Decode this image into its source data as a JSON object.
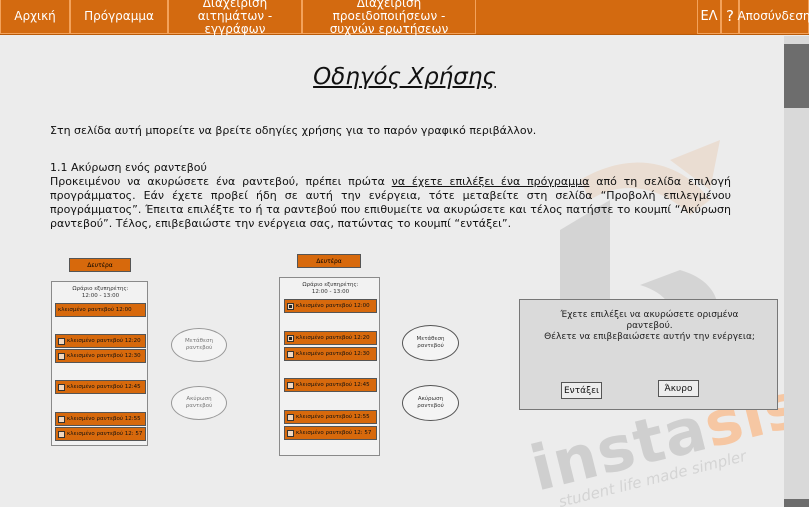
{
  "nav": {
    "home": "Αρχική",
    "program": "Πρόγραμμα",
    "requests_line1": "Διαχείριση",
    "requests_line2": "αιτημάτων - εγγράφων",
    "notifications_line1": "Διαχείριση προειδοποιήσεων -",
    "notifications_line2": "συχνών ερωτήσεων",
    "language": "ΕΛ",
    "help": "?",
    "logout": "Αποσύνδεση"
  },
  "page": {
    "title": "Οδηγός Χρήσης",
    "intro": "Στη σελίδα αυτή μπορείτε να βρείτε οδηγίες χρήσης για το παρόν γραφικό  περιβάλλον.",
    "section1": {
      "title": "1.1 Ακύρωση ενός ραντεβού",
      "body_part1": "Προκειμένου να ακυρώσετε ένα ραντεβού, πρέπει πρώτα ",
      "body_link": "να έχετε επιλέξει ένα πρόγραμμα",
      "body_part2": " από τη σελίδα επιλογή προγράμματος. Εάν έχετε προβεί ήδη σε αυτή την ενέργεια, τότε μεταβείτε στη σελίδα “Προβολή επιλεγμένου προγράμματος”. Έπειτα επιλέξτε το ή τα ραντεβού που επιθυμείτε να ακυρώσετε και τέλος πατήστε το κουμπί “Ακύρωση ραντεβού”. Τέλος, επιβεβαιώστε την ενέργεια σας, πατώντας το κουμπί “εντάξει”."
    }
  },
  "mockup": {
    "day": "Δευτέρα",
    "hours_line1": "Ωράριο εξυπηρέτης:",
    "hours_line2": "12:00 - 13:00",
    "slots": [
      "κλεισμένο ραντεβού 12:00",
      "κλεισμένο ραντεβού 12:20",
      "κλεισμένο ραντεβού 12:30",
      "κλεισμένο ραντεβού 12:45",
      "κλεισμένο ραντεβού 12:55",
      "κλεισμένο ραντεβού 12: 57"
    ],
    "move_line1": "Μετάθεση",
    "move_line2": "ραντεβού",
    "cancel_line1": "Ακύρωση",
    "cancel_line2": "ραντεβού"
  },
  "dialog": {
    "line1": "Έχετε επιλέξει να ακυρώσετε ορισμένα",
    "line2": "ραντεβού.",
    "line3": "Θέλετε να επιβεβαιώσετε αυτήν την ενέργεια;",
    "ok": "Εντάξει",
    "cancel": "Άκυρο"
  },
  "watermark": {
    "text_main": "insta",
    "text_accent": "sis",
    "tagline": "student life made simpler"
  },
  "colors": {
    "nav_bg": "#d36a10",
    "accent": "#d7690c",
    "page_bg": "#ececec"
  }
}
